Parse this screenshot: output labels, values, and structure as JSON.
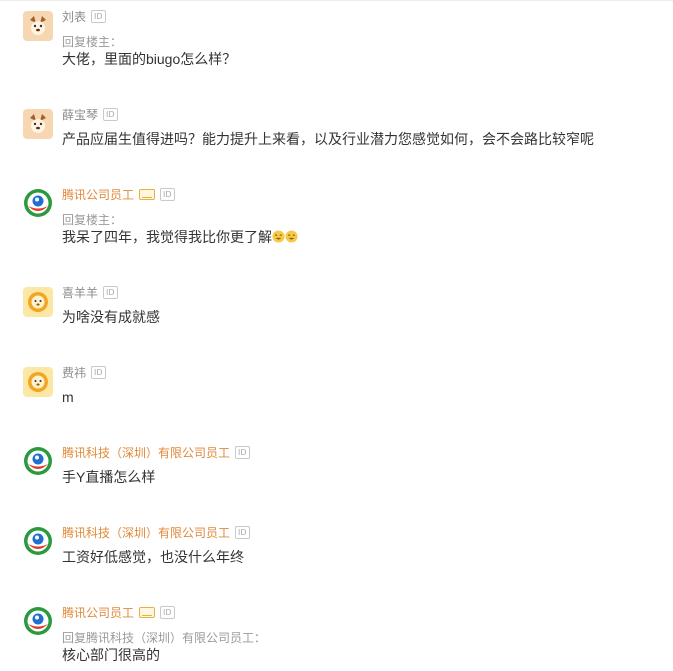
{
  "comments": [
    {
      "name": "刘表",
      "is_org": false,
      "avatar": "dog-avatar",
      "reply_label": "回复楼主：",
      "text": "大佬，里面的biugo怎么样？"
    },
    {
      "name": "薛宝琴",
      "is_org": false,
      "avatar": "dog-avatar",
      "reply_label": "",
      "text": "产品应届生值得进吗？能力提升上来看，以及行业潜力您感觉如何，会不会路比较窄呢"
    },
    {
      "name": "腾讯公司员工",
      "is_org": true,
      "verified": true,
      "avatar": "tencent-logo",
      "reply_label": "回复楼主：",
      "text": "我呆了四年，我觉得我比你更了解",
      "emoji_count": 2
    },
    {
      "name": "喜羊羊",
      "is_org": false,
      "avatar": "lion-avatar",
      "reply_label": "",
      "text": "为啥没有成就感"
    },
    {
      "name": "费祎",
      "is_org": false,
      "avatar": "lion-avatar",
      "reply_label": "",
      "text": "m"
    },
    {
      "name": "腾讯科技（深圳）有限公司员工",
      "is_org": true,
      "avatar": "tencent-logo",
      "reply_label": "",
      "text": "手Y直播怎么样"
    },
    {
      "name": "腾讯科技（深圳）有限公司员工",
      "is_org": true,
      "avatar": "tencent-logo",
      "reply_label": "",
      "text": "工资好低感觉，也没什么年终"
    },
    {
      "name": "腾讯公司员工",
      "is_org": true,
      "verified": true,
      "avatar": "tencent-logo",
      "reply_label": "回复腾讯科技（深圳）有限公司员工：",
      "text": "核心部门很高的"
    }
  ],
  "id_badge": "ID",
  "colors": {
    "org_name": "#e0893a",
    "user_name": "#8b8b8b",
    "text": "#333333",
    "reply": "#9a9a9a"
  }
}
